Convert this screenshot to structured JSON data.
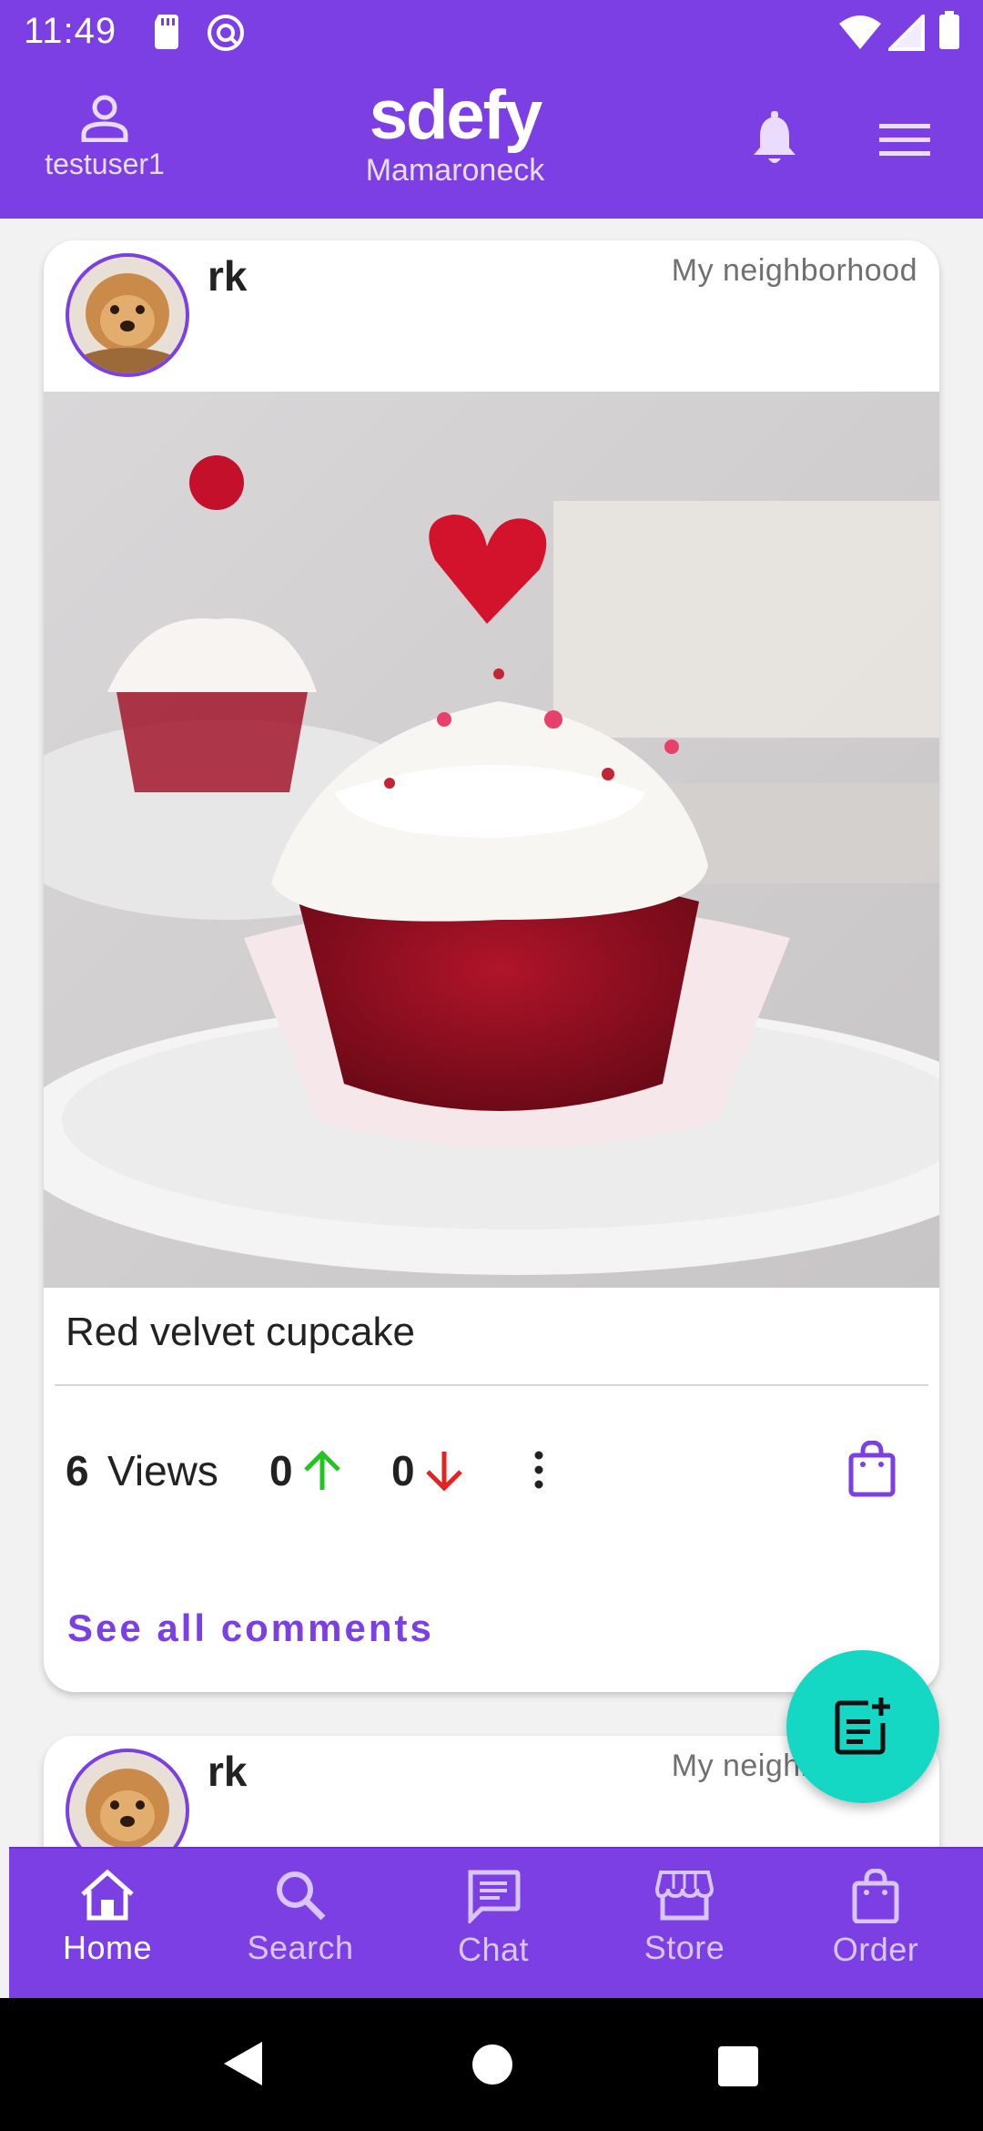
{
  "status": {
    "time": "11:49"
  },
  "header": {
    "username": "testuser1",
    "brand": "sdefy",
    "location": "Mamaroneck"
  },
  "posts": [
    {
      "author": "rk",
      "scope": "My neighborhood",
      "title": "Red velvet cupcake",
      "views_count": "6",
      "views_label": "Views",
      "upvotes": "0",
      "downvotes": "0",
      "comments_link": "See all comments"
    },
    {
      "author": "rk",
      "scope": "My neighborhood"
    }
  ],
  "bottom_nav": [
    {
      "label": "Home",
      "icon": "home-icon",
      "active": true
    },
    {
      "label": "Search",
      "icon": "search-icon"
    },
    {
      "label": "Chat",
      "icon": "chat-icon"
    },
    {
      "label": "Store",
      "icon": "store-icon"
    },
    {
      "label": "Order",
      "icon": "shopping-bag-icon"
    }
  ],
  "colors": {
    "primary": "#7b3fe4",
    "fab": "#14d8c3",
    "upvote": "#22c322",
    "downvote": "#e52222"
  }
}
